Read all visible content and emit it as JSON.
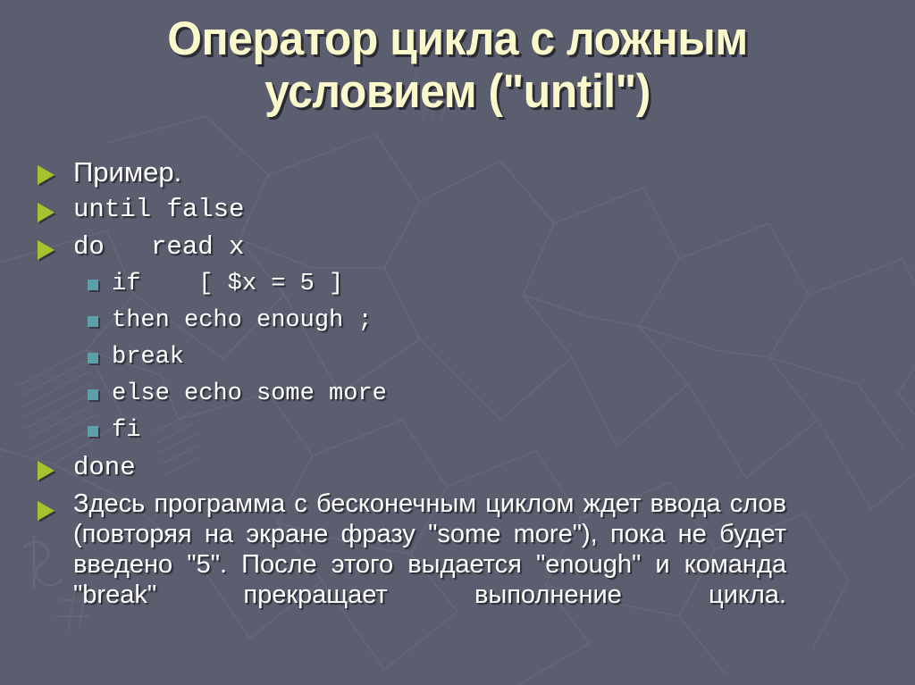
{
  "slide": {
    "background_color": "#5a5e6e",
    "title_color": "#fbf8cc",
    "text_color": "#ffffff",
    "bullet1_color": "#a5c32f",
    "bullet2_color": "#5c9fa8",
    "title": {
      "line1": "Оператор цикла с ложным",
      "line2": "условием (\"until\")"
    },
    "bullets": [
      {
        "level": 1,
        "style": "sans",
        "text": "Пример."
      },
      {
        "level": 1,
        "style": "mono",
        "text": "until false"
      },
      {
        "level": 1,
        "style": "mono",
        "text": "do   read x"
      },
      {
        "level": 2,
        "style": "mono",
        "text": "if    [ $x = 5 ]"
      },
      {
        "level": 2,
        "style": "mono",
        "text": "then echo enough ;"
      },
      {
        "level": 2,
        "style": "mono",
        "text": "break"
      },
      {
        "level": 2,
        "style": "mono",
        "text": "else echo some more"
      },
      {
        "level": 2,
        "style": "mono",
        "text": "fi"
      },
      {
        "level": 1,
        "style": "mono",
        "text": "done"
      }
    ],
    "paragraph": "Здесь программа с бесконечным циклом ждет ввода слов (повторяя на экране фразу \"some more\"), пока не будет введено \"5\". После этого выдается \"enough\" и команда \"break\" прекращает выполнение цикла."
  }
}
